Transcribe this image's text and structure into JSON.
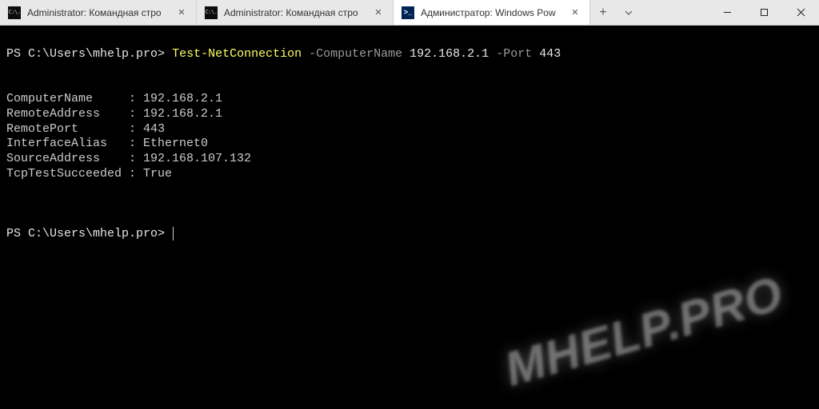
{
  "tabs": [
    {
      "title": "Administrator: Командная стро",
      "icon": "cmd",
      "active": false
    },
    {
      "title": "Administrator: Командная стро",
      "icon": "cmd",
      "active": false
    },
    {
      "title": "Администратор: Windows Pow",
      "icon": "ps",
      "active": true
    }
  ],
  "prompt1": {
    "path": "PS C:\\Users\\mhelp.pro>",
    "cmdlet": "Test-NetConnection",
    "param1": "-ComputerName",
    "arg1": "192.168.2.1",
    "param2": "-Port",
    "arg2": "443"
  },
  "output": [
    {
      "label": "ComputerName     : ",
      "value": "192.168.2.1"
    },
    {
      "label": "RemoteAddress    : ",
      "value": "192.168.2.1"
    },
    {
      "label": "RemotePort       : ",
      "value": "443"
    },
    {
      "label": "InterfaceAlias   : ",
      "value": "Ethernet0"
    },
    {
      "label": "SourceAddress    : ",
      "value": "192.168.107.132"
    },
    {
      "label": "TcpTestSucceeded : ",
      "value": "True"
    }
  ],
  "prompt2": {
    "path": "PS C:\\Users\\mhelp.pro>"
  },
  "watermark": "MHELP.PRO",
  "cmd_icon_text": "C:\\.",
  "ps_icon_text": ">_"
}
